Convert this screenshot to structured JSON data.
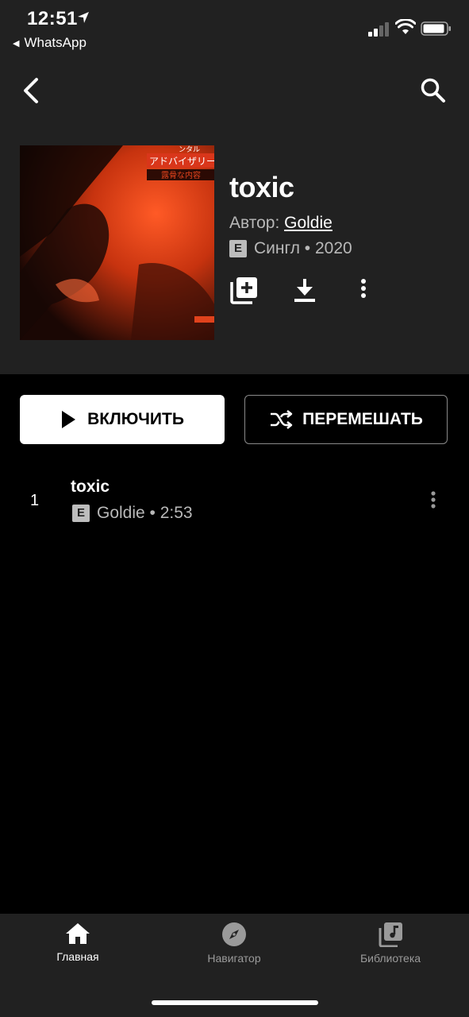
{
  "status_bar": {
    "time": "12:51",
    "back_app": "WhatsApp"
  },
  "header": {
    "back_icon": "chevron-left-icon",
    "search_icon": "search-icon"
  },
  "album": {
    "title": "toxic",
    "author_prefix": "Автор:",
    "author": "Goldie",
    "explicit_badge": "E",
    "type_year": "Сингл • 2020",
    "cover_text_1": "ンタル",
    "cover_text_2": "アドバイザリー",
    "cover_text_3": "露骨な内容",
    "actions": {
      "add_icon": "library-add-icon",
      "download_icon": "download-icon",
      "more_icon": "more-vert-icon"
    }
  },
  "buttons": {
    "play": "ВКЛЮЧИТЬ",
    "shuffle": "ПЕРЕМЕШАТЬ"
  },
  "tracks": [
    {
      "number": "1",
      "title": "toxic",
      "explicit": "E",
      "meta": "Goldie • 2:53"
    }
  ],
  "nav": {
    "items": [
      {
        "label": "Главная",
        "icon": "home-icon",
        "active": true
      },
      {
        "label": "Навигатор",
        "icon": "compass-icon",
        "active": false
      },
      {
        "label": "Библиотека",
        "icon": "library-music-icon",
        "active": false
      }
    ]
  },
  "colors": {
    "header_bg": "#212121",
    "body_bg": "#000000",
    "cover_accent": "#e0421c"
  }
}
